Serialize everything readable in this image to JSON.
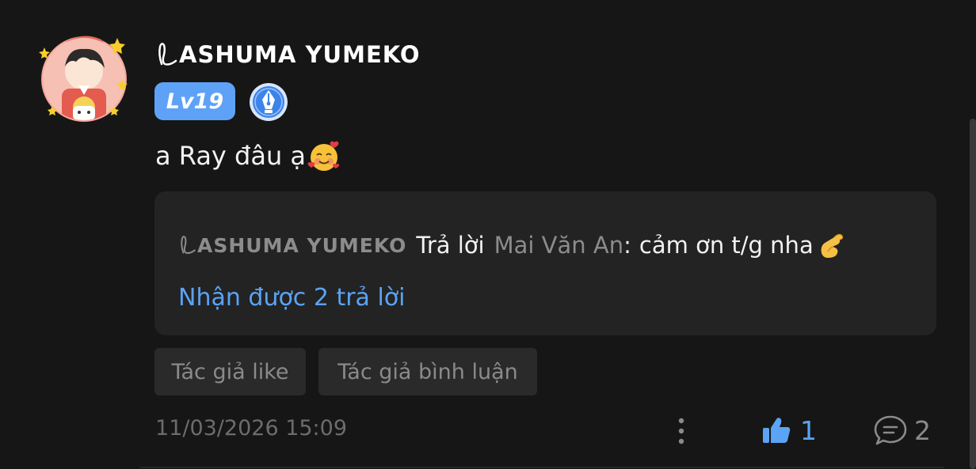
{
  "comment": {
    "author": "ASHUMA YUMEKO",
    "level": "Lv19",
    "text": "a Ray đâu ạ",
    "text_emoji": "smiling-face-with-hearts",
    "reply_preview": {
      "author": "ASHUMA YUMEKO",
      "verb": "Trả lời",
      "target": "Mai Văn An",
      "colon": ":",
      "body": "cảm ơn t/g nha",
      "body_emoji": "pinching-hand",
      "count_label": "Nhận được 2 trả lời"
    },
    "tags": [
      "Tác giả like",
      "Tác giả bình luận"
    ],
    "timestamp": "11/03/2026 15:09",
    "likes": "1",
    "comments": "2"
  },
  "icons": {
    "avatar": "anime-avatar-with-stars",
    "badge": "fountain-pen-badge-icon",
    "more": "more-vertical-icon",
    "like": "thumbs-up-icon",
    "comment": "comment-bubble-icon"
  },
  "colors": {
    "background": "#161616",
    "accent": "#5aa3f5",
    "level_badge": "#5ea2f7",
    "reply_box": "#232323",
    "tag_bg": "#2a2a2a",
    "muted_text": "#8c8c8c"
  }
}
